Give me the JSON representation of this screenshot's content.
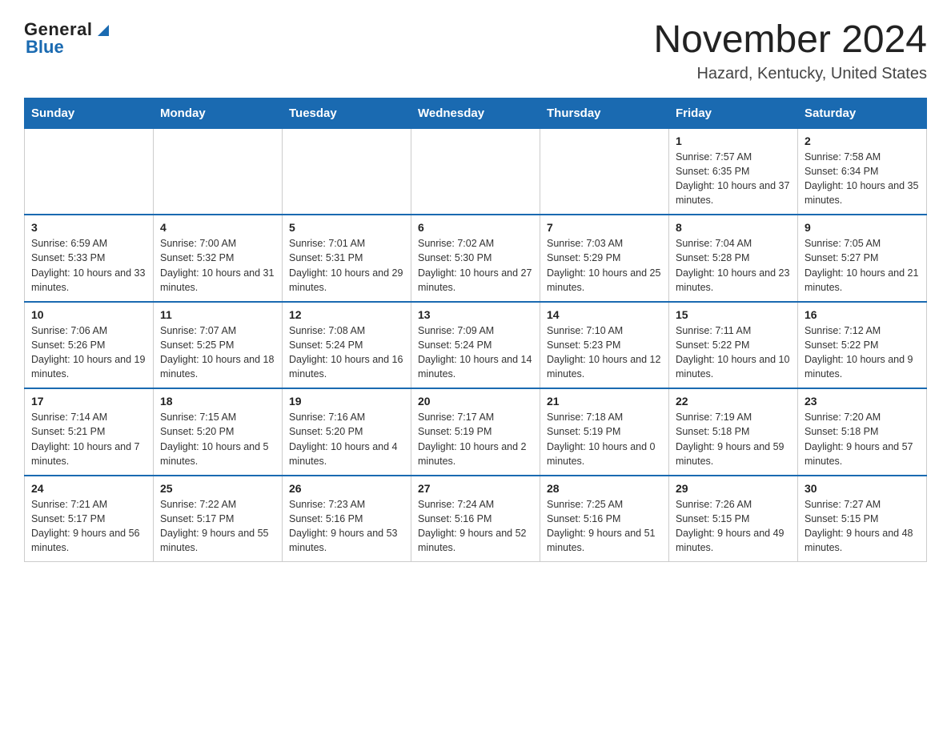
{
  "header": {
    "logo_general": "General",
    "logo_blue": "Blue",
    "title": "November 2024",
    "subtitle": "Hazard, Kentucky, United States"
  },
  "days_of_week": [
    "Sunday",
    "Monday",
    "Tuesday",
    "Wednesday",
    "Thursday",
    "Friday",
    "Saturday"
  ],
  "weeks": [
    {
      "days": [
        {
          "num": "",
          "info": ""
        },
        {
          "num": "",
          "info": ""
        },
        {
          "num": "",
          "info": ""
        },
        {
          "num": "",
          "info": ""
        },
        {
          "num": "",
          "info": ""
        },
        {
          "num": "1",
          "info": "Sunrise: 7:57 AM\nSunset: 6:35 PM\nDaylight: 10 hours and 37 minutes."
        },
        {
          "num": "2",
          "info": "Sunrise: 7:58 AM\nSunset: 6:34 PM\nDaylight: 10 hours and 35 minutes."
        }
      ]
    },
    {
      "days": [
        {
          "num": "3",
          "info": "Sunrise: 6:59 AM\nSunset: 5:33 PM\nDaylight: 10 hours and 33 minutes."
        },
        {
          "num": "4",
          "info": "Sunrise: 7:00 AM\nSunset: 5:32 PM\nDaylight: 10 hours and 31 minutes."
        },
        {
          "num": "5",
          "info": "Sunrise: 7:01 AM\nSunset: 5:31 PM\nDaylight: 10 hours and 29 minutes."
        },
        {
          "num": "6",
          "info": "Sunrise: 7:02 AM\nSunset: 5:30 PM\nDaylight: 10 hours and 27 minutes."
        },
        {
          "num": "7",
          "info": "Sunrise: 7:03 AM\nSunset: 5:29 PM\nDaylight: 10 hours and 25 minutes."
        },
        {
          "num": "8",
          "info": "Sunrise: 7:04 AM\nSunset: 5:28 PM\nDaylight: 10 hours and 23 minutes."
        },
        {
          "num": "9",
          "info": "Sunrise: 7:05 AM\nSunset: 5:27 PM\nDaylight: 10 hours and 21 minutes."
        }
      ]
    },
    {
      "days": [
        {
          "num": "10",
          "info": "Sunrise: 7:06 AM\nSunset: 5:26 PM\nDaylight: 10 hours and 19 minutes."
        },
        {
          "num": "11",
          "info": "Sunrise: 7:07 AM\nSunset: 5:25 PM\nDaylight: 10 hours and 18 minutes."
        },
        {
          "num": "12",
          "info": "Sunrise: 7:08 AM\nSunset: 5:24 PM\nDaylight: 10 hours and 16 minutes."
        },
        {
          "num": "13",
          "info": "Sunrise: 7:09 AM\nSunset: 5:24 PM\nDaylight: 10 hours and 14 minutes."
        },
        {
          "num": "14",
          "info": "Sunrise: 7:10 AM\nSunset: 5:23 PM\nDaylight: 10 hours and 12 minutes."
        },
        {
          "num": "15",
          "info": "Sunrise: 7:11 AM\nSunset: 5:22 PM\nDaylight: 10 hours and 10 minutes."
        },
        {
          "num": "16",
          "info": "Sunrise: 7:12 AM\nSunset: 5:22 PM\nDaylight: 10 hours and 9 minutes."
        }
      ]
    },
    {
      "days": [
        {
          "num": "17",
          "info": "Sunrise: 7:14 AM\nSunset: 5:21 PM\nDaylight: 10 hours and 7 minutes."
        },
        {
          "num": "18",
          "info": "Sunrise: 7:15 AM\nSunset: 5:20 PM\nDaylight: 10 hours and 5 minutes."
        },
        {
          "num": "19",
          "info": "Sunrise: 7:16 AM\nSunset: 5:20 PM\nDaylight: 10 hours and 4 minutes."
        },
        {
          "num": "20",
          "info": "Sunrise: 7:17 AM\nSunset: 5:19 PM\nDaylight: 10 hours and 2 minutes."
        },
        {
          "num": "21",
          "info": "Sunrise: 7:18 AM\nSunset: 5:19 PM\nDaylight: 10 hours and 0 minutes."
        },
        {
          "num": "22",
          "info": "Sunrise: 7:19 AM\nSunset: 5:18 PM\nDaylight: 9 hours and 59 minutes."
        },
        {
          "num": "23",
          "info": "Sunrise: 7:20 AM\nSunset: 5:18 PM\nDaylight: 9 hours and 57 minutes."
        }
      ]
    },
    {
      "days": [
        {
          "num": "24",
          "info": "Sunrise: 7:21 AM\nSunset: 5:17 PM\nDaylight: 9 hours and 56 minutes."
        },
        {
          "num": "25",
          "info": "Sunrise: 7:22 AM\nSunset: 5:17 PM\nDaylight: 9 hours and 55 minutes."
        },
        {
          "num": "26",
          "info": "Sunrise: 7:23 AM\nSunset: 5:16 PM\nDaylight: 9 hours and 53 minutes."
        },
        {
          "num": "27",
          "info": "Sunrise: 7:24 AM\nSunset: 5:16 PM\nDaylight: 9 hours and 52 minutes."
        },
        {
          "num": "28",
          "info": "Sunrise: 7:25 AM\nSunset: 5:16 PM\nDaylight: 9 hours and 51 minutes."
        },
        {
          "num": "29",
          "info": "Sunrise: 7:26 AM\nSunset: 5:15 PM\nDaylight: 9 hours and 49 minutes."
        },
        {
          "num": "30",
          "info": "Sunrise: 7:27 AM\nSunset: 5:15 PM\nDaylight: 9 hours and 48 minutes."
        }
      ]
    }
  ]
}
